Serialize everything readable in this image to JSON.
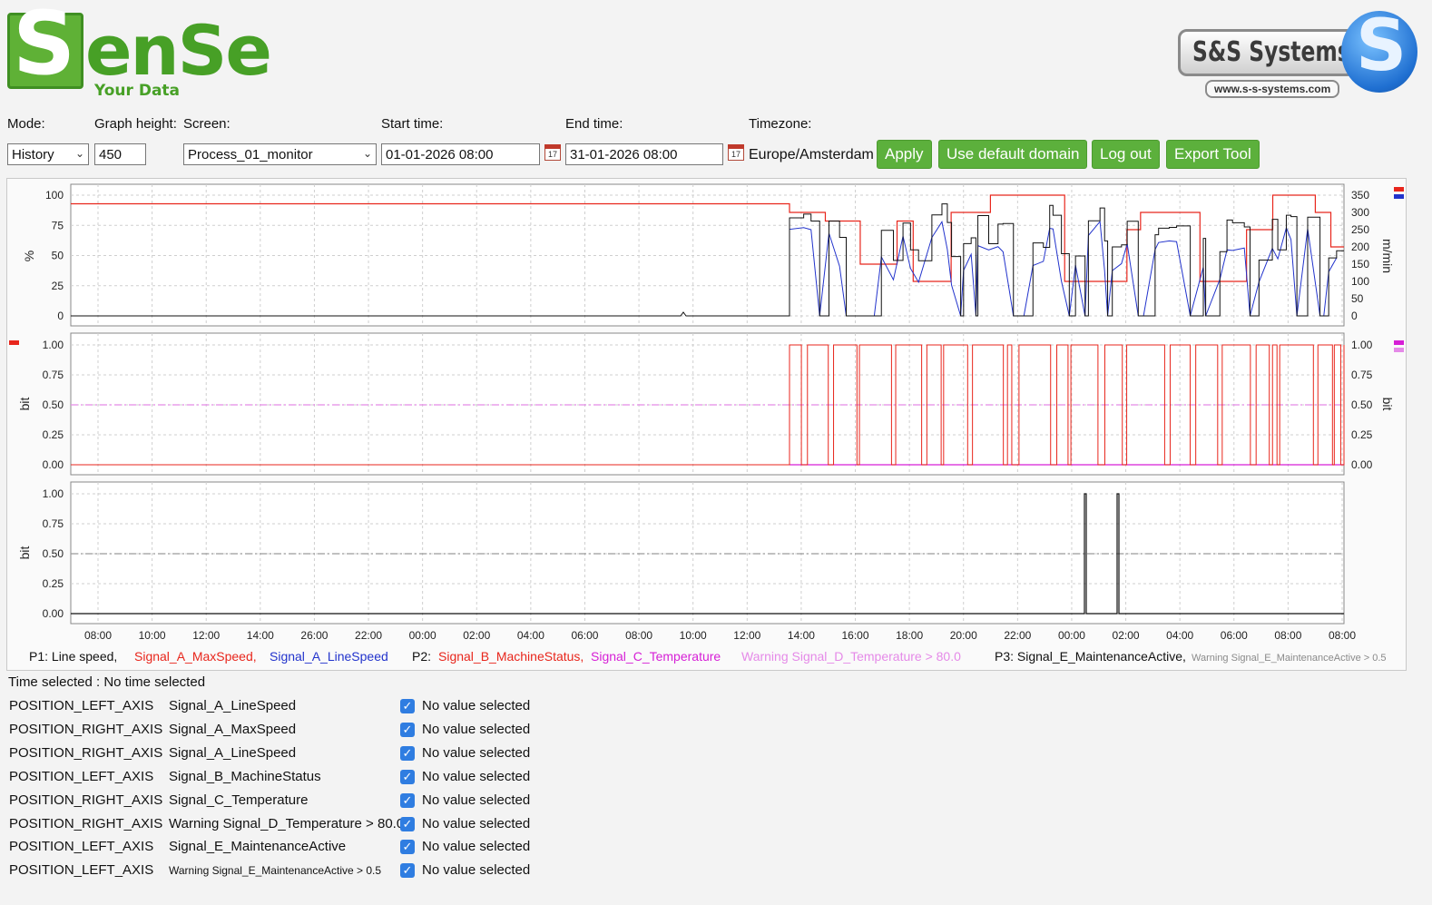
{
  "logo": {
    "main_text": "SenSe",
    "tagline": "Your Data"
  },
  "partner_logo": {
    "name": "S&S Systems",
    "url": "www.s-s-systems.com"
  },
  "controls": {
    "mode_label": "Mode:",
    "mode_value": "History",
    "graph_height_label": "Graph height:",
    "graph_height_value": "450",
    "screen_label": "Screen:",
    "screen_value": "Process_01_monitor",
    "start_label": "Start time:",
    "start_value": "01-01-2026 08:00",
    "end_label": "End time:",
    "end_value": "31-01-2026 08:00",
    "timezone_label": "Timezone:",
    "timezone_value": "Europe/Amsterdam",
    "calendar_day": "17"
  },
  "buttons": {
    "apply": "Apply",
    "default_domain": "Use default domain",
    "logout": "Log out",
    "export": "Export Tool"
  },
  "colors": {
    "red": "#e8261c",
    "blue": "#2233cc",
    "black": "#111111",
    "magenta": "#d61fd6",
    "light_magenta": "#e58ae8",
    "grey_dash": "#9a9a9a",
    "button_green": "#5cb03c"
  },
  "chart_data": [
    {
      "type": "line",
      "panel": "P1",
      "ylabel_left": "%",
      "ylabel_right": "m/min",
      "yticks_left": [
        "100",
        "75",
        "50",
        "25",
        "0"
      ],
      "yticks_right": [
        "350",
        "300",
        "250",
        "200",
        "150",
        "100",
        "50",
        "0"
      ],
      "ylim_left": [
        0,
        100
      ],
      "ylim_right": [
        0,
        350
      ],
      "series": [
        {
          "name": "Signal_A_MaxSpeed",
          "color": "#e8261c",
          "axis": "right",
          "level_before_activity": 325
        },
        {
          "name": "Signal_A_LineSpeed",
          "color": "#2233cc",
          "axis": "right"
        },
        {
          "name": "Line speed",
          "color": "#111111",
          "axis": "left",
          "level_before_activity": 0
        }
      ]
    },
    {
      "type": "line",
      "panel": "P2",
      "ylabel_left": "bit",
      "ylabel_right": "bit",
      "yticks": [
        "1.00",
        "0.75",
        "0.50",
        "0.25",
        "0.00"
      ],
      "ylim": [
        0,
        1
      ],
      "series": [
        {
          "name": "Signal_B_MachineStatus",
          "color": "#e8261c"
        },
        {
          "name": "Signal_C_Temperature",
          "color": "#d61fd6"
        },
        {
          "name": "Warning Signal_D_Temperature > 80.0",
          "color": "#e58ae8",
          "threshold": 0.5
        }
      ]
    },
    {
      "type": "line",
      "panel": "P3",
      "ylabel_left": "bit",
      "yticks": [
        "1.00",
        "0.75",
        "0.50",
        "0.25",
        "0.00"
      ],
      "ylim": [
        0,
        1
      ],
      "series": [
        {
          "name": "Signal_E_MaintenanceActive",
          "color": "#111111",
          "pulses_at": [
            "01:00",
            "02:15"
          ]
        },
        {
          "name": "Warning Signal_E_MaintenanceActive > 0.5",
          "color": "#9a9a9a",
          "threshold": 0.5
        }
      ]
    }
  ],
  "x_ticks": [
    "08:00",
    "10:00",
    "12:00",
    "14:00",
    "26:00",
    "22:00",
    "00:00",
    "02:00",
    "04:00",
    "06:00",
    "08:00",
    "10:00",
    "12:00",
    "14:00",
    "16:00",
    "18:00",
    "20:00",
    "22:00",
    "00:00",
    "02:00",
    "04:00",
    "06:00",
    "08:00",
    "08:00"
  ],
  "legend": [
    {
      "text": "P1: Line speed,",
      "color": "#111111"
    },
    {
      "text": "Signal_A_MaxSpeed,",
      "color": "#e8261c"
    },
    {
      "text": "Signal_A_LineSpeed",
      "color": "#2233cc"
    },
    {
      "text": "P2:",
      "color": "#111111"
    },
    {
      "text": "Signal_B_MachineStatus,",
      "color": "#e8261c"
    },
    {
      "text": "Signal_C_Temperature",
      "color": "#d61fd6"
    },
    {
      "text": "Warning Signal_D_Temperature > 80.0",
      "color": "#e58ae8"
    },
    {
      "text": "P3: Signal_E_MaintenanceActive,",
      "color": "#111111"
    },
    {
      "text": "Warning Signal_E_MaintenanceActive > 0.5",
      "color": "#8a8a8a"
    }
  ],
  "time_selected": "Time selected : No time selected",
  "signals": [
    {
      "position": "POSITION_LEFT_AXIS",
      "signal": "Signal_A_LineSpeed",
      "checked": true,
      "value": "No value selected"
    },
    {
      "position": "POSITION_RIGHT_AXIS",
      "signal": "Signal_A_MaxSpeed",
      "checked": true,
      "value": "No value selected"
    },
    {
      "position": "POSITION_RIGHT_AXIS",
      "signal": "Signal_A_LineSpeed",
      "checked": true,
      "value": "No value selected"
    },
    {
      "position": "POSITION_LEFT_AXIS",
      "signal": "Signal_B_MachineStatus",
      "checked": true,
      "value": "No value selected"
    },
    {
      "position": "POSITION_RIGHT_AXIS",
      "signal": "Signal_C_Temperature",
      "checked": true,
      "value": "No value selected"
    },
    {
      "position": "POSITION_RIGHT_AXIS",
      "signal": "Warning Signal_D_Temperature > 80.0",
      "checked": true,
      "value": "No value selected"
    },
    {
      "position": "POSITION_LEFT_AXIS",
      "signal": "Signal_E_MaintenanceActive",
      "checked": true,
      "value": "No value selected"
    },
    {
      "position": "POSITION_LEFT_AXIS",
      "signal": "Warning Signal_E_MaintenanceActive > 0.5",
      "checked": true,
      "value": "No value selected"
    }
  ]
}
